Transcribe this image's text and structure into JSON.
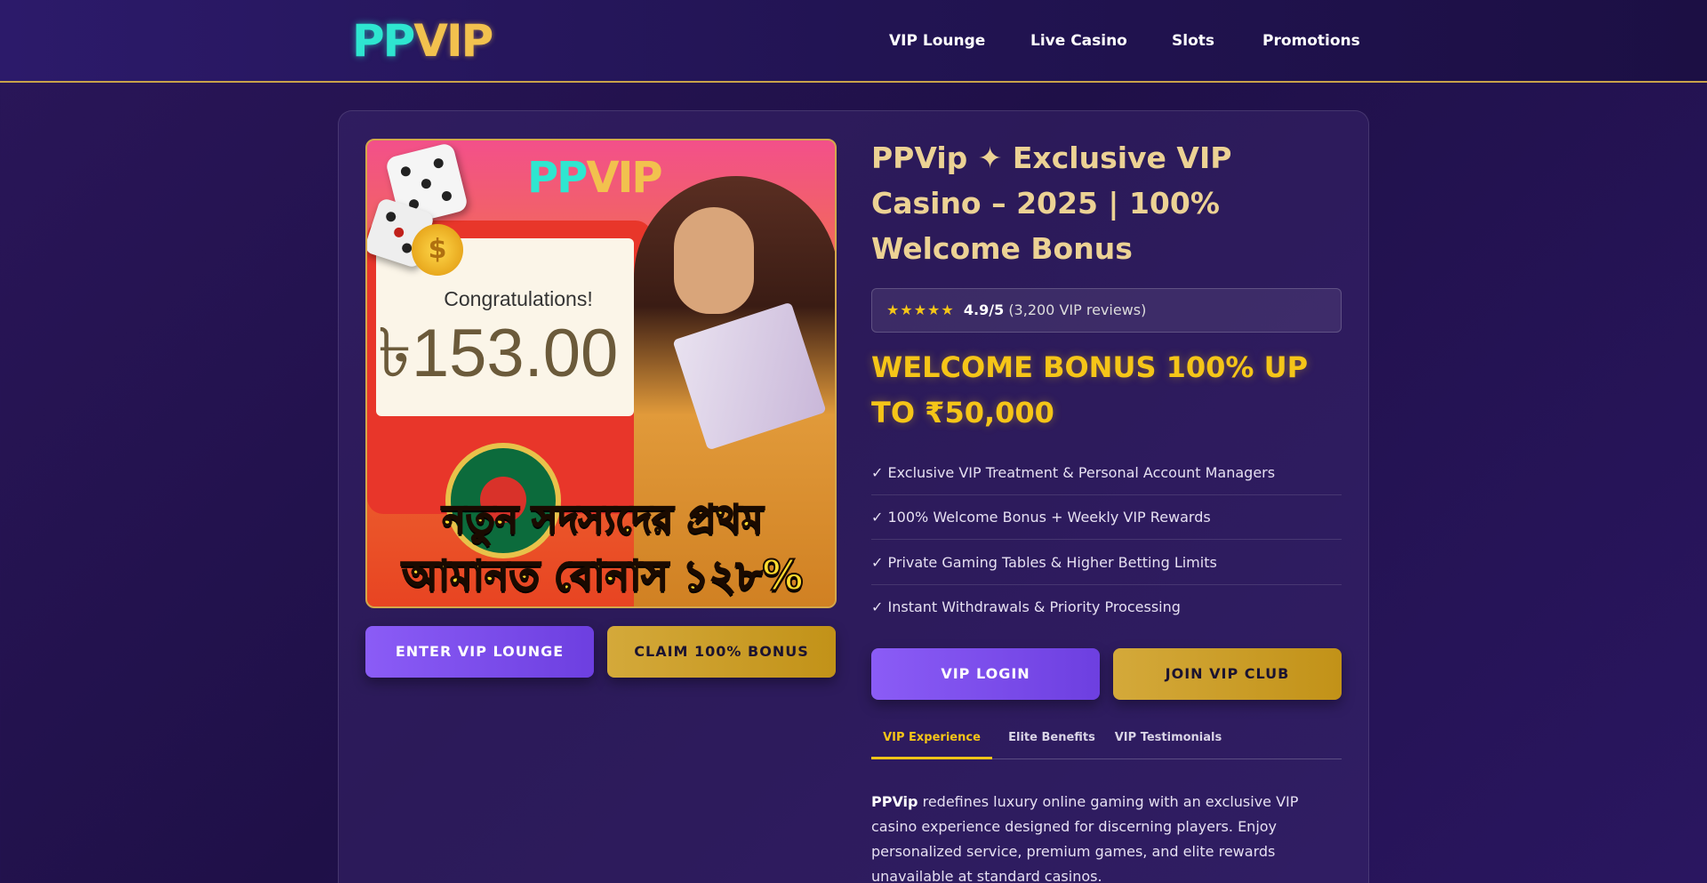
{
  "header": {
    "logo_pp": "PP",
    "logo_vip": "VIP",
    "nav": [
      "VIP Lounge",
      "Live Casino",
      "Slots",
      "Promotions"
    ]
  },
  "banner": {
    "logo_pp": "PP",
    "logo_vip": "VIP",
    "congrats": "Congratulations!",
    "amount": "৳153.00",
    "coin_symbol": "$",
    "bengali_line1": "নতুন সদস্যদের প্রথম",
    "bengali_line2": "আমানত বোনাস ১২৮%"
  },
  "left_buttons": {
    "enter": "ENTER VIP LOUNGE",
    "claim": "CLAIM 100% BONUS"
  },
  "hero": {
    "title": "PPVip ✦ Exclusive VIP Casino – 2025 | 100% Welcome Bonus",
    "stars": "★★★★★",
    "score": "4.9",
    "score_suffix": "/5",
    "reviews": "(3,200 VIP reviews)",
    "bonus": "WELCOME BONUS 100% UP TO ₹50,000",
    "features": [
      "✓ Exclusive VIP Treatment & Personal Account Managers",
      "✓ 100% Welcome Bonus + Weekly VIP Rewards",
      "✓ Private Gaming Tables & Higher Betting Limits",
      "✓ Instant Withdrawals & Priority Processing"
    ],
    "login": "VIP LOGIN",
    "join": "JOIN VIP CLUB"
  },
  "tabs": [
    "VIP Experience",
    "Elite Benefits",
    "VIP Testimonials"
  ],
  "description": {
    "brand": "PPVip",
    "text": " redefines luxury online gaming with an exclusive VIP casino experience designed for discerning players. Enjoy personalized service, premium games, and elite rewards unavailable at standard casinos."
  },
  "colors": {
    "accent_gold": "#f5c518",
    "accent_purple": "#8b5cf6",
    "title_gold": "#ecd294",
    "logo_teal": "#2ee6d0"
  }
}
